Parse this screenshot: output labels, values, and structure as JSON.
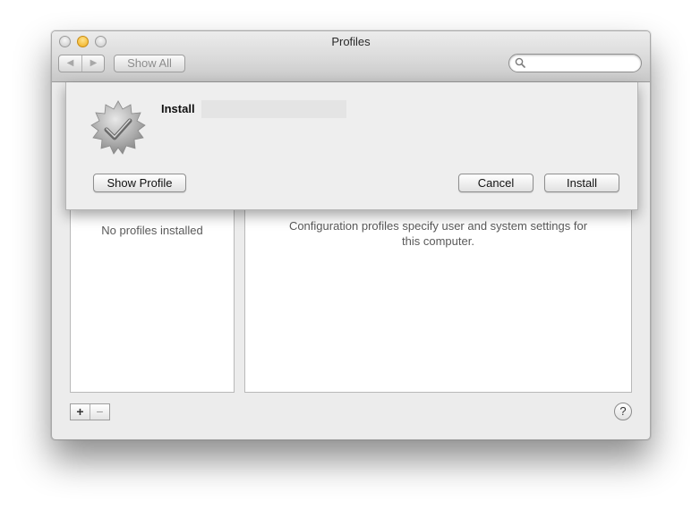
{
  "window": {
    "title": "Profiles",
    "toolbar": {
      "back_glyph": "◀",
      "forward_glyph": "▶",
      "show_all_label": "Show All",
      "search_value": "",
      "search_placeholder": ""
    }
  },
  "sheet": {
    "title_label": "Install",
    "icon": "verified-badge-icon",
    "show_profile_label": "Show Profile",
    "cancel_label": "Cancel",
    "install_label": "Install"
  },
  "profiles_list": {
    "empty_text": "No profiles installed"
  },
  "details": {
    "description": "Configuration profiles specify user and system settings for this computer."
  },
  "footer": {
    "add_label": "+",
    "remove_label": "−",
    "help_label": "?"
  },
  "colors": {
    "window_bg": "#ececec",
    "minimize_light": "#f0ad1a",
    "pane_bg": "#ffffff"
  }
}
